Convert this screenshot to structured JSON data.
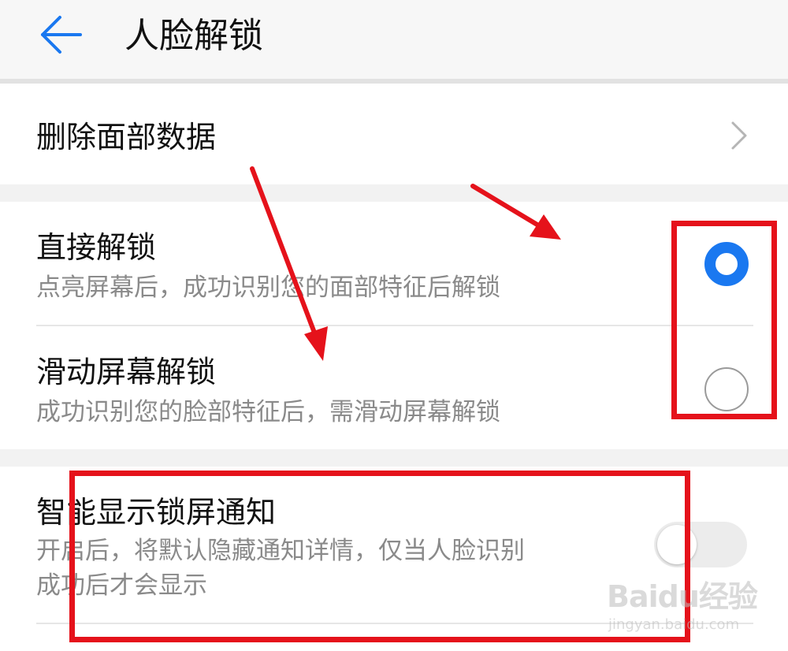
{
  "header": {
    "back_icon": "arrow-left-icon",
    "title": "人脸解锁"
  },
  "delete_face": {
    "label": "删除面部数据",
    "chevron_icon": "chevron-right-icon"
  },
  "unlock_mode": {
    "options": [
      {
        "title": "直接解锁",
        "subtitle": "点亮屏幕后，成功识别您的面部特征后解锁",
        "selected": true
      },
      {
        "title": "滑动屏幕解锁",
        "subtitle": "成功识别您的脸部特征后，需滑动屏幕解锁",
        "selected": false
      }
    ]
  },
  "smart_notification": {
    "title": "智能显示锁屏通知",
    "subtitle_line1": "开启后，将默认隐藏通知详情，仅当人脸识别",
    "subtitle_line2": "成功后才会显示",
    "enabled": false
  },
  "watermark": {
    "main": "Baidu经验",
    "sub": "jingyan.baidu.com"
  },
  "colors": {
    "accent": "#1a78f0",
    "annotation_red": "#e5121b"
  }
}
